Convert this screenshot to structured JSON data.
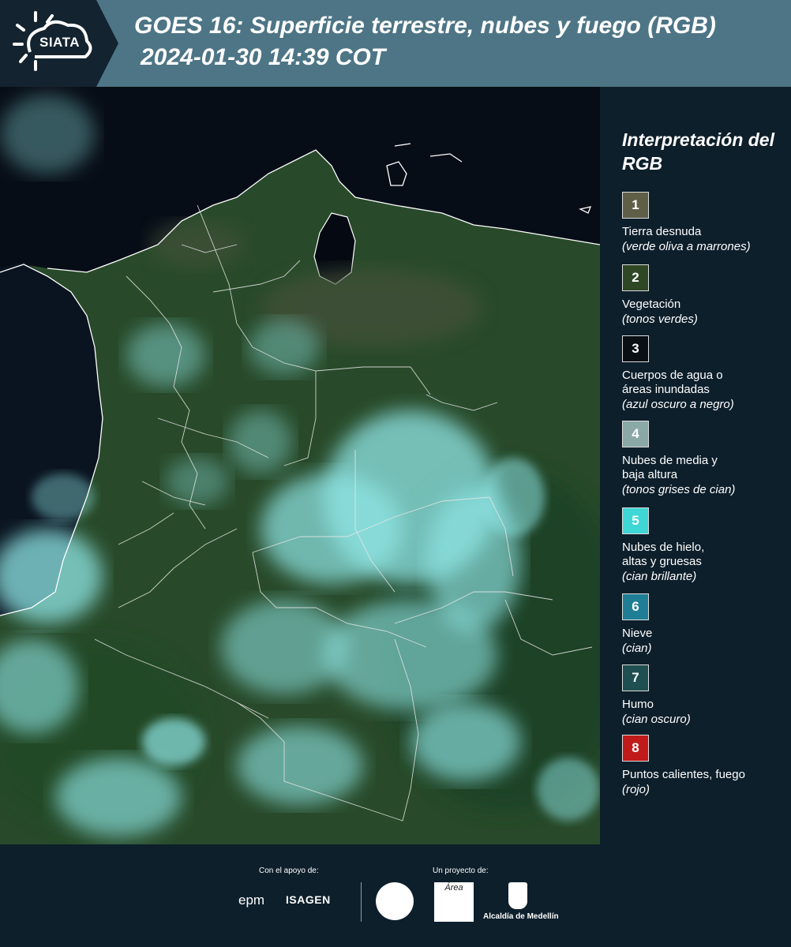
{
  "header": {
    "logo_text": "SIATA",
    "title": "GOES 16: Superficie terrestre, nubes y fuego (RGB)",
    "datetime": "2024-01-30 14:39 COT"
  },
  "legend": {
    "title": "Interpretación del RGB",
    "items": [
      {
        "number": "1",
        "color": "#5f5f48",
        "label": "Tierra desnuda",
        "sub": "(verde oliva a marrones)"
      },
      {
        "number": "2",
        "color": "#2f4724",
        "label": "Vegetación",
        "sub": "(tonos verdes)"
      },
      {
        "number": "3",
        "color": "#0a0f14",
        "label": "Cuerpos de agua o\náreas inundadas",
        "sub": "(azul oscuro a negro)"
      },
      {
        "number": "4",
        "color": "#8aa8a6",
        "label": "Nubes de media y\nbaja altura",
        "sub": "(tonos grises de cian)"
      },
      {
        "number": "5",
        "color": "#3fd6d6",
        "label": "Nubes de hielo,\naltas y gruesas",
        "sub": "(cian brillante)"
      },
      {
        "number": "6",
        "color": "#1f7e95",
        "label": "Nieve",
        "sub": "(cian)"
      },
      {
        "number": "7",
        "color": "#1f4f50",
        "label": "Humo",
        "sub": "(cian oscuro)"
      },
      {
        "number": "8",
        "color": "#c01a1a",
        "label": "Puntos calientes, fuego",
        "sub": "(rojo)"
      }
    ]
  },
  "footer": {
    "support_label": "Con el apoyo de:",
    "project_label": "Un proyecto de:",
    "sponsors": [
      "epm",
      "ISAGEN"
    ],
    "area_logo_text": "Área",
    "alcaldia_text": "Alcaldía de Medellín"
  },
  "colors": {
    "header_bg": "#4d7586",
    "page_bg": "#0d1f2b",
    "ocean": "#070d16",
    "land": "#2b4a2a",
    "cloud": "#8fe6e6"
  }
}
